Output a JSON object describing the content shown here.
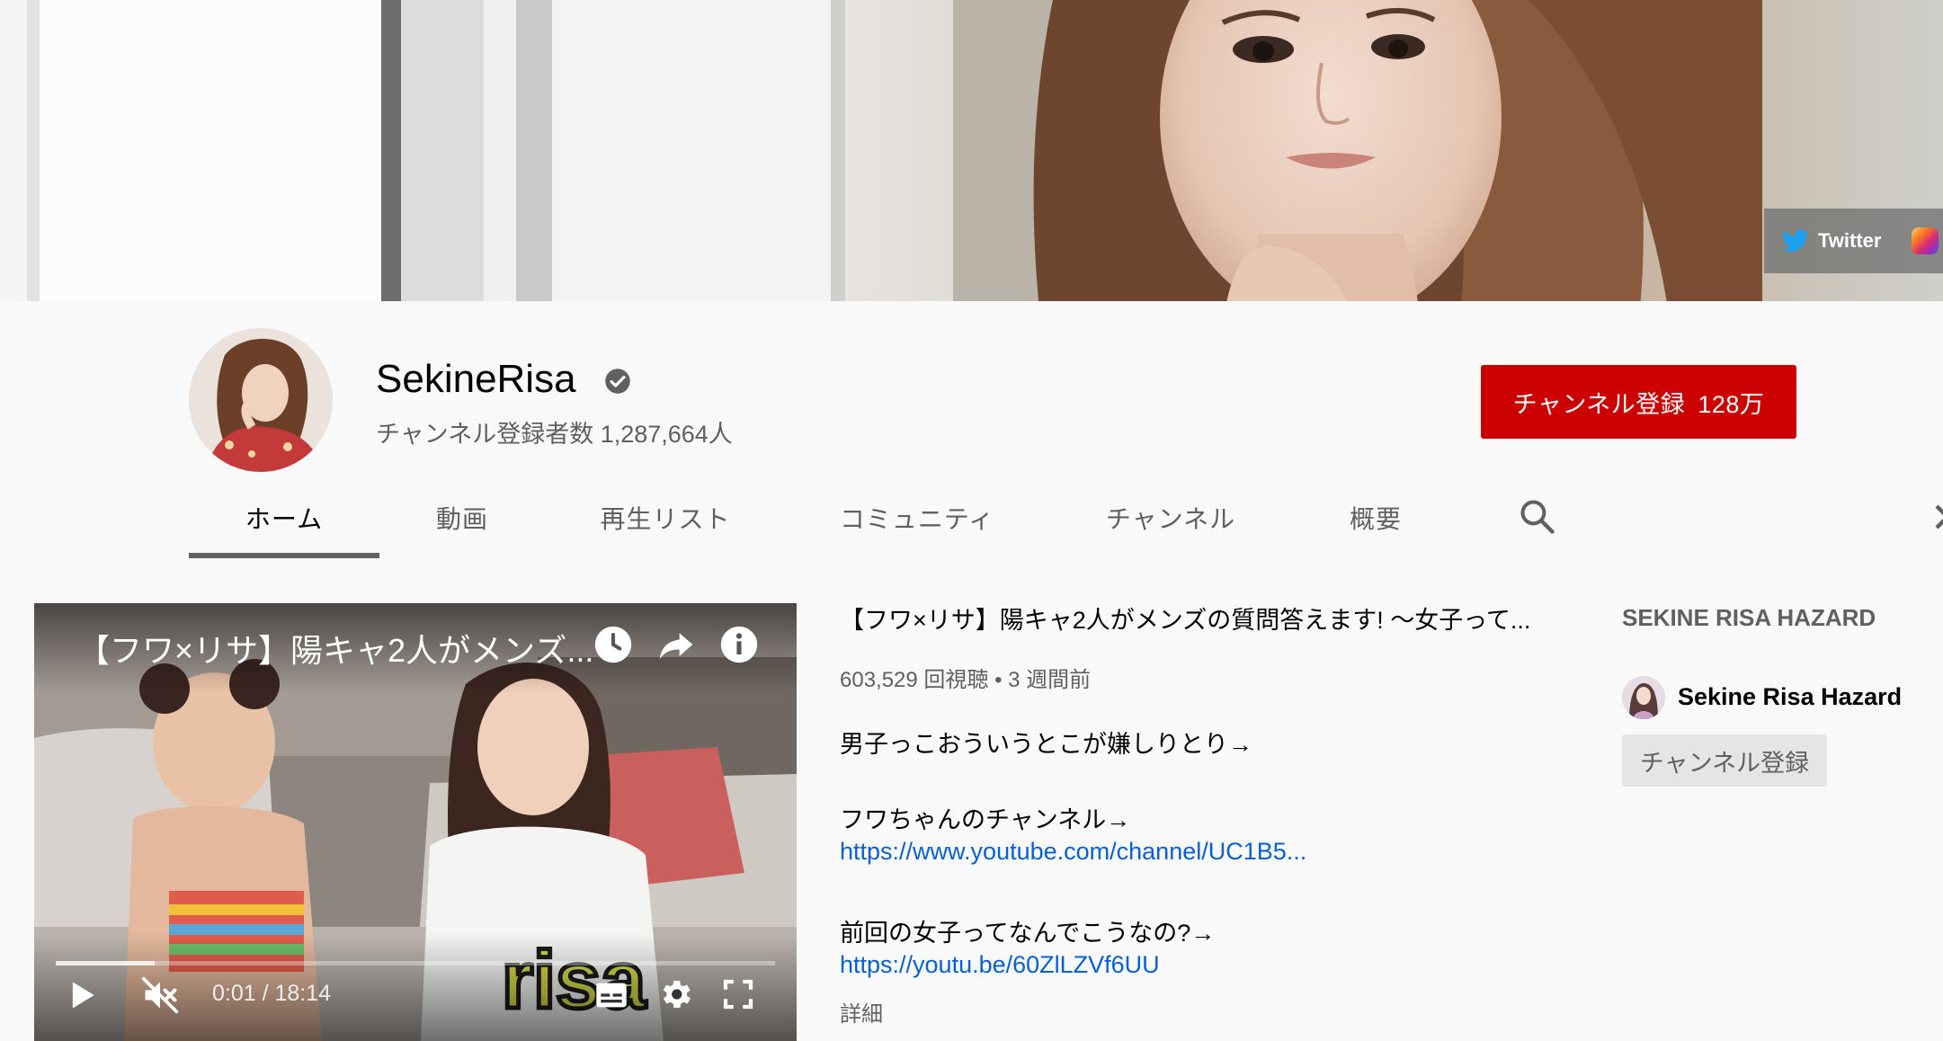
{
  "banner": {
    "social_links": [
      {
        "label": "Twitter",
        "icon": "twitter-icon"
      },
      {
        "label": "",
        "icon": "instagram-icon"
      }
    ]
  },
  "channel": {
    "name": "SekineRisa",
    "verified_icon": "verified-check-icon",
    "subscriber_text": "チャンネル登録者数 1,287,664人",
    "subscribe_button": {
      "label": "チャンネル登録",
      "count": "128万"
    }
  },
  "tabs": [
    {
      "label": "ホーム",
      "active": true
    },
    {
      "label": "動画"
    },
    {
      "label": "再生リスト"
    },
    {
      "label": "コミュニティ"
    },
    {
      "label": "チャンネル"
    },
    {
      "label": "概要"
    }
  ],
  "player": {
    "title": "【フワ×リサ】陽キャ2人がメンズ...",
    "time": "0:01 / 18:14",
    "progress": 0.001,
    "overlay_word": "risa"
  },
  "video": {
    "title": "【フワ×リサ】陽キャ2人がメンズの質問答えます! ～女子って...",
    "meta": "603,529 回視聴 • 3 週間前",
    "description": [
      {
        "type": "text",
        "text": "男子っこおういうとこが嫌しりとり→"
      },
      {
        "type": "text",
        "text": "フワちゃんのチャンネル→"
      },
      {
        "type": "link",
        "text": "https://www.youtube.com/channel/UC1B5..."
      },
      {
        "type": "text",
        "text": "前回の女子ってなんでこうなの?→"
      },
      {
        "type": "link",
        "text": "https://youtu.be/60ZlLZVf6UU"
      }
    ],
    "more_label": "詳細"
  },
  "featured": {
    "heading": "SEKINE RISA HAZARD",
    "channel_name": "Sekine Risa Hazard",
    "subscribe_label": "チャンネル登録"
  },
  "colors": {
    "subscribe_red": "#cc0000",
    "link_blue": "#065fd4",
    "secondary_text": "#606060",
    "background": "#f9f9f9"
  }
}
